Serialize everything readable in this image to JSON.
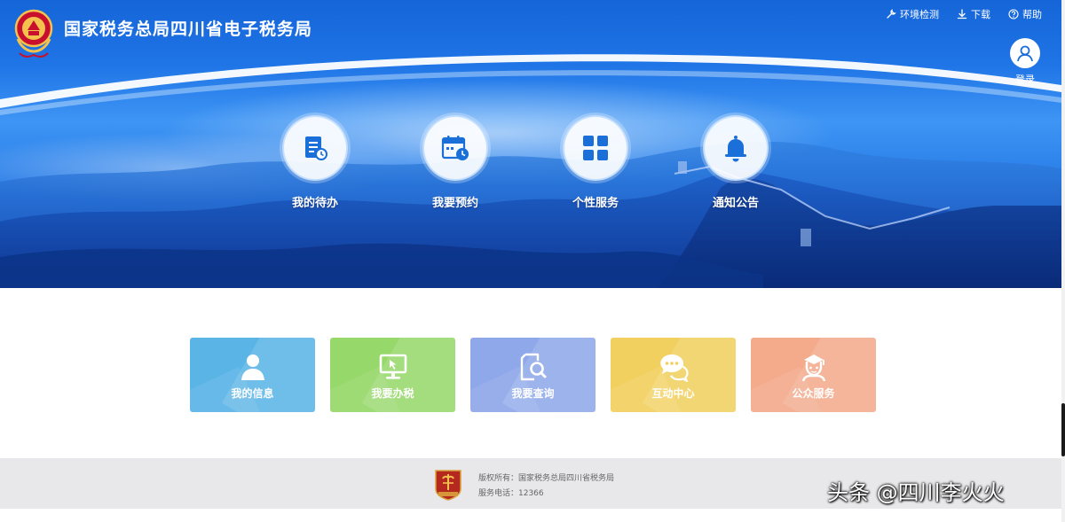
{
  "header": {
    "site_title": "国家税务总局四川省电子税务局",
    "links": [
      {
        "label": "环境检测",
        "icon": "wrench-icon"
      },
      {
        "label": "下载",
        "icon": "download-icon"
      },
      {
        "label": "帮助",
        "icon": "help-icon"
      }
    ],
    "login_label": "登录"
  },
  "quick_nav": [
    {
      "label": "我的待办",
      "icon": "todo-list-icon"
    },
    {
      "label": "我要预约",
      "icon": "calendar-clock-icon"
    },
    {
      "label": "个性服务",
      "icon": "grid-apps-icon"
    },
    {
      "label": "通知公告",
      "icon": "bell-icon"
    }
  ],
  "cards": [
    {
      "label": "我的信息",
      "icon": "user-icon",
      "color": "#5ab4e6"
    },
    {
      "label": "我要办税",
      "icon": "monitor-icon",
      "color": "#96d86a"
    },
    {
      "label": "我要查询",
      "icon": "search-document-icon",
      "color": "#8fa8ea"
    },
    {
      "label": "互动中心",
      "icon": "chat-bubbles-icon",
      "color": "#f2d060"
    },
    {
      "label": "公众服务",
      "icon": "service-person-icon",
      "color": "#f3ab8c"
    }
  ],
  "footer": {
    "copyright": "版权所有：国家税务总局四川省税务局",
    "phone": "服务电话：12366"
  },
  "watermark": "头条 @四川李火火",
  "colors": {
    "hero_blue": "#1f74e6",
    "accent_blue": "#1a6fd8",
    "footer_bg": "#e8e8ea"
  }
}
